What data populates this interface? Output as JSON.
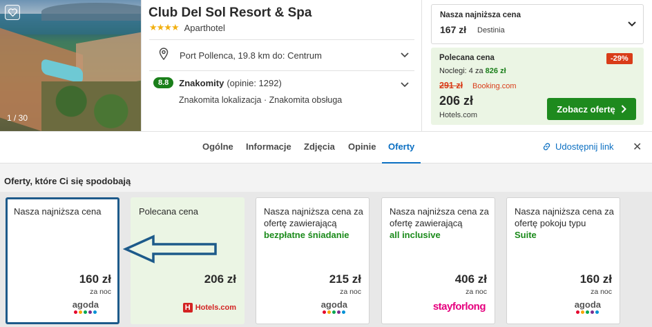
{
  "gallery": {
    "counter": "1 / 30"
  },
  "hotel": {
    "name": "Club Del Sol Resort & Spa",
    "stars": "★★★★",
    "type": "Aparthotel",
    "location": "Port Pollenca, 19.8 km do: Centrum",
    "rating": {
      "score": "8.8",
      "word": "Znakomity",
      "count": "(opinie: 1292)",
      "sub": "Znakomita lokalizacja · Znakomita obsługa"
    }
  },
  "lowest": {
    "label": "Nasza najniższa cena",
    "price": "167 zł",
    "provider": "Destinia"
  },
  "recommended": {
    "label": "Polecana cena",
    "discount": "-29%",
    "nights_prefix": "Noclegi: 4 za",
    "nights_total": "826 zł",
    "old_price": "291 zł",
    "old_provider": "Booking.com",
    "price": "206 zł",
    "provider": "Hotels.com",
    "button": "Zobacz ofertę"
  },
  "tabs": [
    "Ogólne",
    "Informacje",
    "Zdjęcia",
    "Opinie",
    "Oferty"
  ],
  "share": "Udostępnij link",
  "section_title": "Oferty, które Ci się spodobają",
  "cards": [
    {
      "lines": "Nasza najniższa cena",
      "highlight": "",
      "price": "160 zł",
      "per": "za noc",
      "logo": "agoda"
    },
    {
      "lines": "Polecana cena",
      "highlight": "",
      "price": "206 zł",
      "per": "",
      "logo": "Hotels.com"
    },
    {
      "lines": "Nasza najniższa cena za ofertę zawierającą",
      "highlight": "bezpłatne śniadanie",
      "price": "215 zł",
      "per": "za noc",
      "logo": "agoda"
    },
    {
      "lines": "Nasza najniższa cena za ofertę zawierającą",
      "highlight": "all inclusive",
      "price": "406 zł",
      "per": "za noc",
      "logo": "stayforlong"
    },
    {
      "lines": "Nasza najniższa cena za ofertę pokoju typu",
      "highlight": "Suite",
      "price": "160 zł",
      "per": "za noc",
      "logo": "agoda"
    }
  ]
}
